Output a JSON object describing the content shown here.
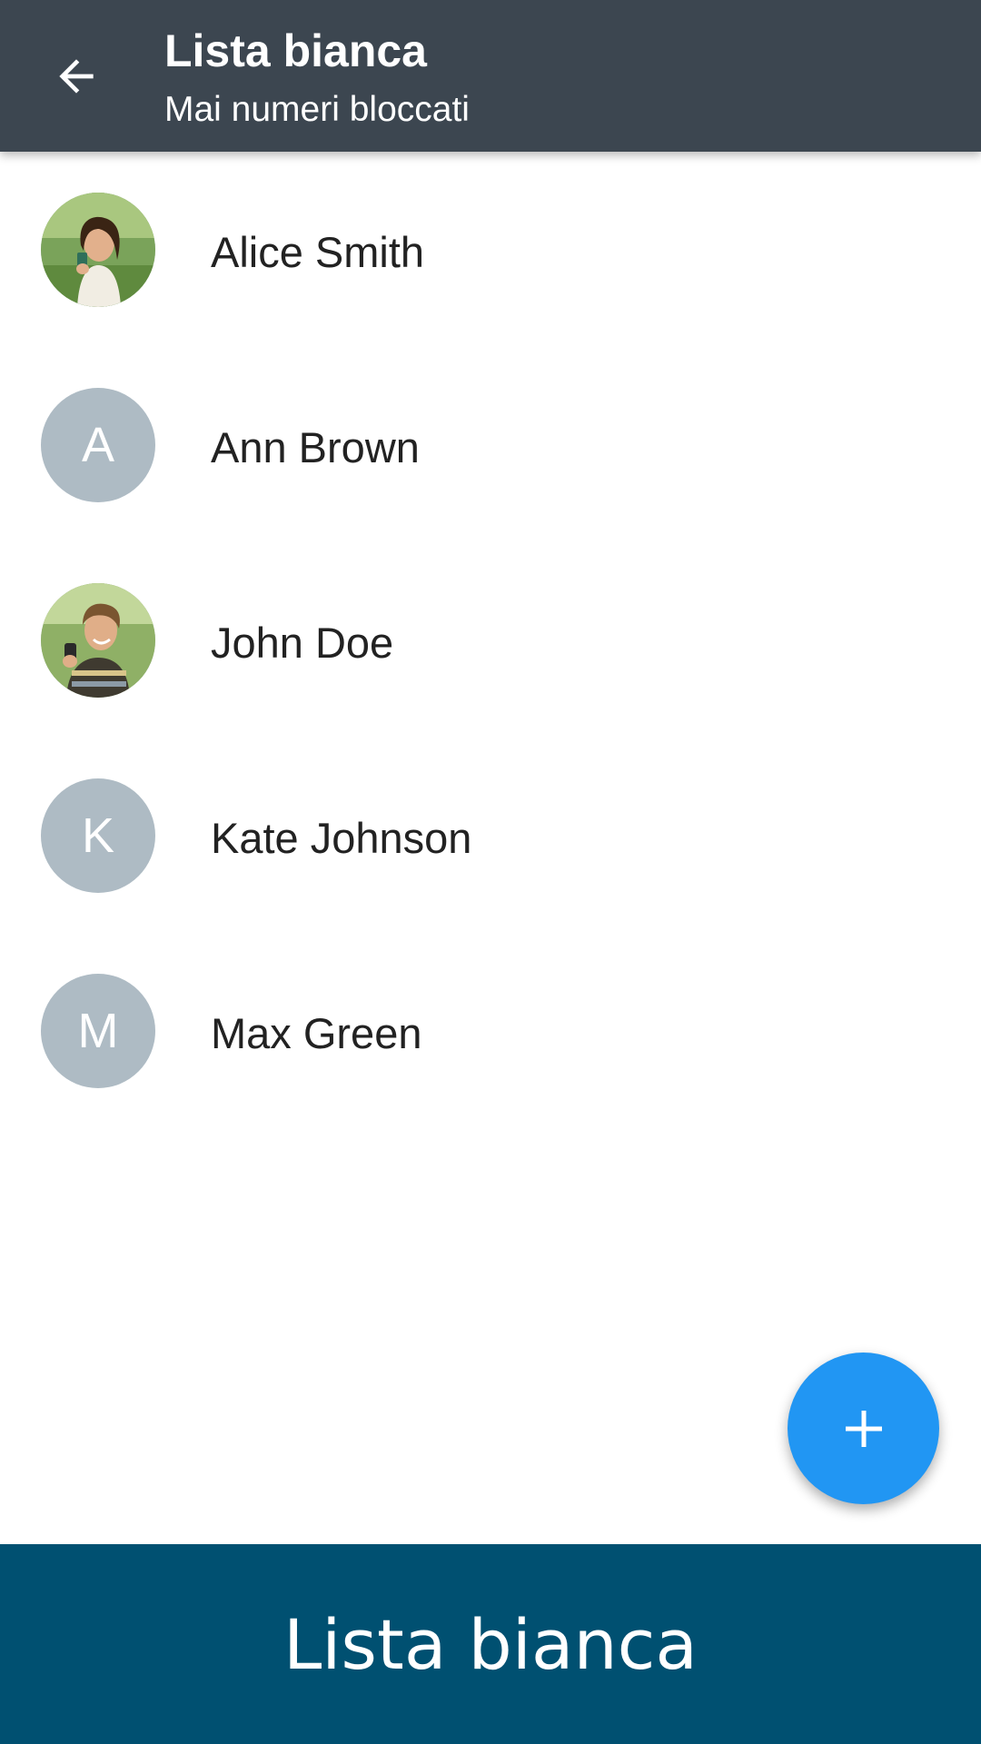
{
  "app_bar": {
    "title": "Lista bianca",
    "subtitle": "Mai numeri bloccati",
    "back_icon": "arrow-back-icon"
  },
  "contacts": [
    {
      "name": "Alice Smith",
      "avatar_type": "photo",
      "initial": ""
    },
    {
      "name": "Ann Brown",
      "avatar_type": "initial",
      "initial": "A"
    },
    {
      "name": "John Doe",
      "avatar_type": "photo",
      "initial": ""
    },
    {
      "name": "Kate Johnson",
      "avatar_type": "initial",
      "initial": "K"
    },
    {
      "name": "Max Green",
      "avatar_type": "initial",
      "initial": "M"
    }
  ],
  "fab": {
    "icon": "plus-icon"
  },
  "banner": {
    "text": "Lista bianca"
  },
  "colors": {
    "app_bar": "#3c4650",
    "avatar_placeholder": "#aebbc4",
    "fab": "#2196f3",
    "banner": "#005071"
  }
}
